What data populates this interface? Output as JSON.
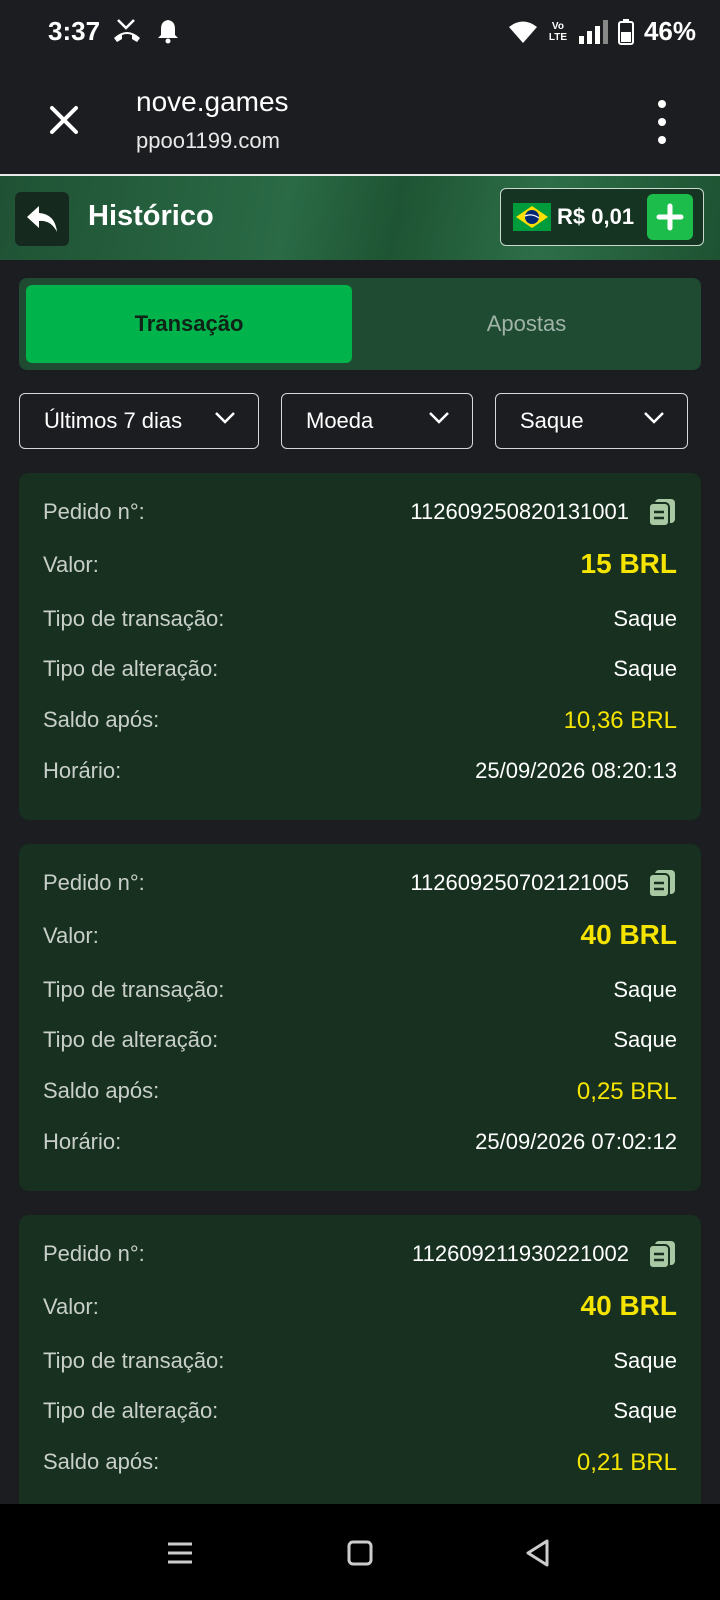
{
  "status_bar": {
    "time": "3:37",
    "battery": "46%",
    "network_label": "Vo LTE"
  },
  "browser": {
    "title": "nove.games",
    "url": "ppoo1199.com"
  },
  "header": {
    "title": "Histórico",
    "balance": "R$ 0,01"
  },
  "tabs": [
    {
      "label": "Transação",
      "active": true
    },
    {
      "label": "Apostas",
      "active": false
    }
  ],
  "filters": {
    "period": "Últimos 7 dias",
    "currency": "Moeda",
    "type": "Saque"
  },
  "labels": {
    "order": "Pedido n°:",
    "value": "Valor:",
    "transaction_type": "Tipo de transação:",
    "change_type": "Tipo de alteração:",
    "balance_after": "Saldo após:",
    "time": "Horário:"
  },
  "transactions": [
    {
      "order": "112609250820131001",
      "value": "15 BRL",
      "transaction_type": "Saque",
      "change_type": "Saque",
      "balance_after": "10,36 BRL",
      "time": "25/09/2026 08:20:13"
    },
    {
      "order": "112609250702121005",
      "value": "40 BRL",
      "transaction_type": "Saque",
      "change_type": "Saque",
      "balance_after": "0,25 BRL",
      "time": "25/09/2026 07:02:12"
    },
    {
      "order": "112609211930221002",
      "value": "40 BRL",
      "transaction_type": "Saque",
      "change_type": "Saque",
      "balance_after": "0,21 BRL"
    }
  ],
  "colors": {
    "accent_green": "#00b34a",
    "value_yellow": "#f5e400",
    "card_bg": "#17301f"
  }
}
